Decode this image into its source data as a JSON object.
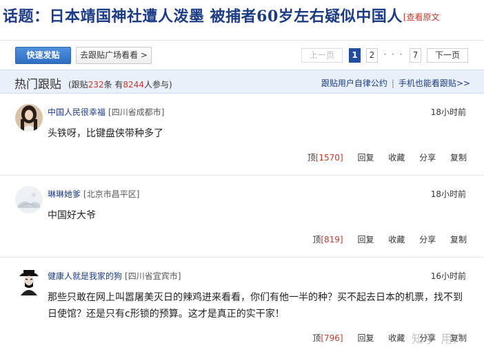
{
  "topic": {
    "title": "话题：日本靖国神社遭人泼墨 被捕者60岁左右疑似中国人",
    "view_source": "[查看原文"
  },
  "toolbar": {
    "quick_post": "快速发贴",
    "plaza": "去跟贴广场看看 >",
    "prev": "上一页",
    "page1": "1",
    "page2": "2",
    "dots": "· · ·",
    "page7": "7",
    "next": "下一页"
  },
  "hot": {
    "title": "热门跟贴",
    "stats_prefix": "(跟贴",
    "reply_count": "232",
    "stats_mid": "条 有",
    "participant_count": "8244",
    "stats_suffix": "人参与)",
    "rules_link": "跟贴用户自律公约",
    "link_sep": "|",
    "mobile_link": "手机也能看跟贴>>"
  },
  "comments": [
    {
      "user": "中国人民很幸福",
      "location": "[四川省成都市]",
      "time": "18小时前",
      "content": "头铁呀，比键盘侠带种多了",
      "up_label": "顶",
      "up_count": "[1570]",
      "reply": "回复",
      "collect": "收藏",
      "share": "分享",
      "copy": "复制"
    },
    {
      "user": "琳琳她爹",
      "location": "[北京市昌平区]",
      "time": "18小时前",
      "content": "中国好大爷",
      "up_label": "顶",
      "up_count": "[819]",
      "reply": "回复",
      "collect": "收藏",
      "share": "分享",
      "copy": "复制"
    },
    {
      "user": "健康人就是我家的狗",
      "location": "[四川省宜宾市]",
      "time": "16小时前",
      "content": "那些只敢在网上叫嚣屠美灭日的辣鸡进来看看，你们有他一半的种？买不起去日本的机票，找不到日使馆？还是只有c形锁的预算。这才是真正的实干家！",
      "up_label": "顶",
      "up_count": "[796]",
      "reply": "回复",
      "collect": "收藏",
      "share": "分享",
      "copy": "复制"
    }
  ],
  "watermark": "知乎 用户",
  "colors": {
    "title_blue": "#1b3b84",
    "accent_red": "#c0392b",
    "header_bg": "#e9f0fa",
    "primary_button": "#3a7ed0"
  }
}
